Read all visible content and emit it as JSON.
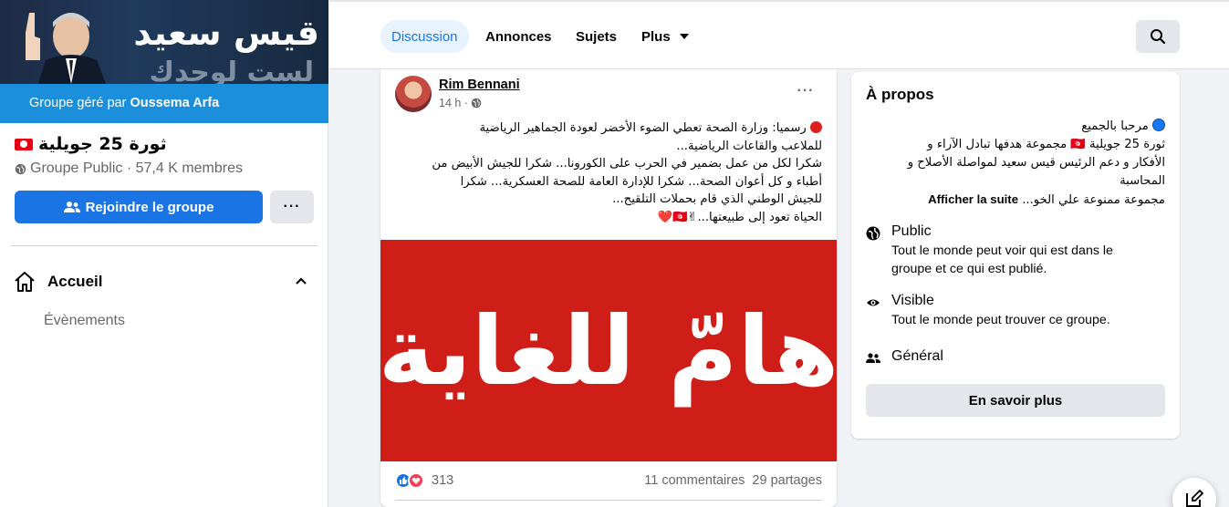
{
  "group": {
    "banner_title": "قيس سعيد",
    "banner_subtitle": "لست لوحدك",
    "managed_prefix": "Groupe géré par",
    "manager_name": "Oussema Arfa",
    "name": "ثورة 25 جويلية",
    "meta": "Groupe Public · 57,4 K membres",
    "join_label": "Rejoindre le groupe",
    "more_label": "···"
  },
  "sidebar": {
    "home_label": "Accueil",
    "events_label": "Évènements"
  },
  "tabs": [
    {
      "label": "Discussion",
      "active": true
    },
    {
      "label": "Annonces",
      "active": false
    },
    {
      "label": "Sujets",
      "active": false
    },
    {
      "label": "Plus",
      "active": false
    }
  ],
  "post": {
    "author": "Rim Bennani",
    "time": "14 h ·",
    "menu_label": "···",
    "lines": [
      "رسميا: وزارة الصحة تعطي الضوء الأخضر لعودة الجماهير الرياضية",
      "للملاعب والقاعات الرياضية...",
      "شكرا لكل من عمل بضمير في الحرب على الكورونا... شكرا للجيش الأبيض من",
      "أطباء و كل أعوان الصحة... شكرا للإدارة العامة للصحة العسكرية... شكرا",
      "للجيش الوطني الذي قام بحملات التلقيح...",
      "الحياة تعود إلى طبيعتها...✌🇹🇳❤️"
    ],
    "image_text": "هامّ للغاية",
    "reaction_count": "313",
    "comments": "11 commentaires",
    "shares": "29 partages"
  },
  "about": {
    "title": "À propos",
    "desc_lines": [
      "مرحبا بالجميع",
      "ثورة 25 جويلية 🇹🇳 مجموعة هدفها تبادل الآراء و",
      "الأفكار و دعم الرئيس قيس سعيد لمواصلة الأصلاح و",
      "المحاسبة",
      "مجموعة ممنوعة علي الخو..."
    ],
    "see_more": "Afficher la suite",
    "public_title": "Public",
    "public_desc": "Tout le monde peut voir qui est dans le groupe et ce qui est publié.",
    "visible_title": "Visible",
    "visible_desc": "Tout le monde peut trouver ce groupe.",
    "general_title": "Général",
    "learn_more": "En savoir plus"
  },
  "colors": {
    "accent": "#1b74e4",
    "managed_bar": "#1b8fdc",
    "post_image": "#cf1d17"
  },
  "icons": [
    "search-icon",
    "globe-icon",
    "eye-icon",
    "people-icon",
    "home-icon",
    "chevron-up-icon",
    "caret-down-icon",
    "compose-icon"
  ]
}
